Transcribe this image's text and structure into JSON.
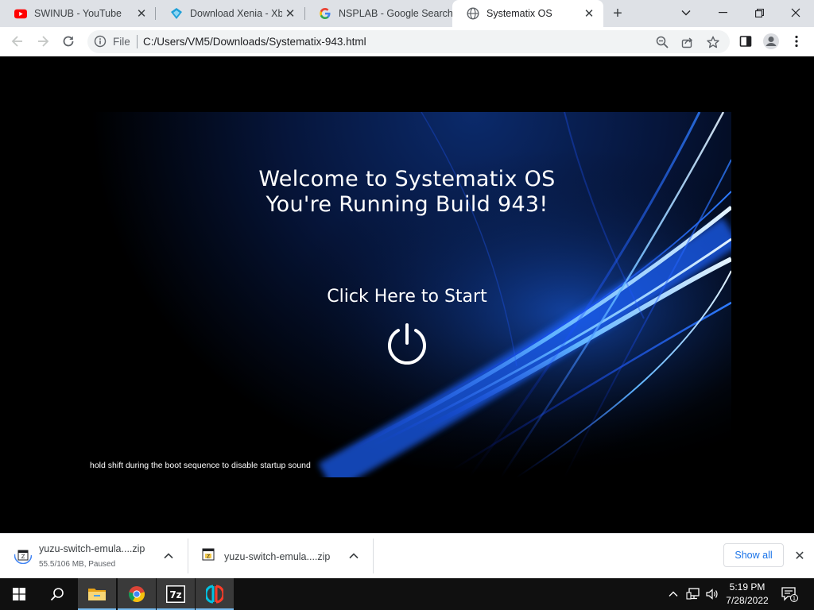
{
  "browser": {
    "tabs": [
      {
        "title": "SWINUB - YouTube",
        "icon": "youtube-icon",
        "active": false
      },
      {
        "title": "Download Xenia - Xbox",
        "icon": "xenia-icon",
        "active": false
      },
      {
        "title": "NSPLAB - Google Search",
        "icon": "google-icon",
        "active": false
      },
      {
        "title": "Systematix OS",
        "icon": "globe-icon",
        "active": true
      }
    ],
    "address": {
      "scheme_label": "File",
      "url": "C:/Users/VM5/Downloads/Systematix-943.html"
    }
  },
  "page": {
    "welcome_line1": "Welcome to Systematix OS",
    "welcome_line2": "You're Running Build 943!",
    "start_label": "Click Here to Start",
    "power_icon": "power-icon",
    "hint": "hold shift during the boot sequence to disable startup sound"
  },
  "downloads": {
    "items": [
      {
        "name": "yuzu-switch-emula....zip",
        "status": "55.5/106 MB, Paused",
        "icon": "zip-archive-icon"
      },
      {
        "name": "yuzu-switch-emula....zip",
        "status": "",
        "icon": "zip-archive-icon"
      }
    ],
    "show_all_label": "Show all"
  },
  "taskbar": {
    "apps": [
      "start-icon",
      "search-icon",
      "file-explorer-icon",
      "chrome-icon",
      "7zip-icon",
      "yuzu-icon"
    ],
    "sevenzip_label": "7z",
    "time": "5:19 PM",
    "date": "7/28/2022",
    "notification_count": "1"
  },
  "colors": {
    "tabstrip": "#dee1e6",
    "accent_link": "#1a73e8",
    "taskbar": "#101010",
    "wallpaper_blue": "#1e6bff"
  }
}
